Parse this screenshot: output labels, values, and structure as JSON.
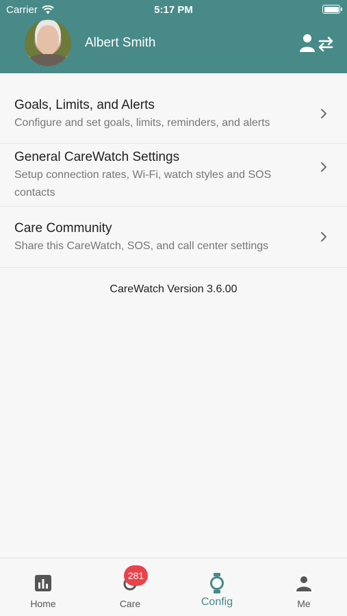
{
  "status_bar": {
    "carrier": "Carrier",
    "time": "5:17 PM"
  },
  "header": {
    "user_name": "Albert Smith"
  },
  "menu": [
    {
      "title": "Goals, Limits, and Alerts",
      "subtitle": "Configure and set goals, limits, reminders, and alerts"
    },
    {
      "title": "General CareWatch Settings",
      "subtitle": "Setup connection rates, Wi-Fi, watch styles and SOS contacts"
    },
    {
      "title": "Care Community",
      "subtitle": "Share this CareWatch, SOS, and call center settings"
    }
  ],
  "version": "CareWatch Version 3.6.00",
  "tabs": [
    {
      "label": "Home",
      "icon": "bar-chart-icon"
    },
    {
      "label": "Care",
      "icon": "care-icon",
      "badge": "281"
    },
    {
      "label": "Config",
      "icon": "watch-icon",
      "active": true
    },
    {
      "label": "Me",
      "icon": "person-icon"
    }
  ],
  "colors": {
    "brand": "#478a88",
    "badge": "#e9434a"
  }
}
